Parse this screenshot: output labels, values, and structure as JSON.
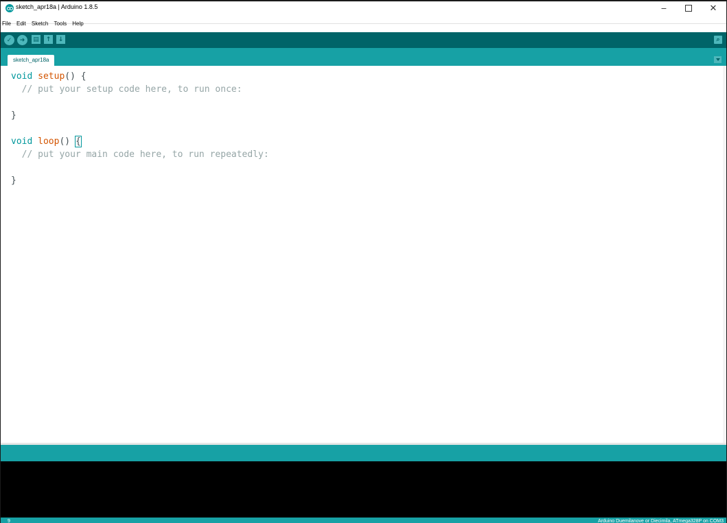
{
  "window": {
    "title": "sketch_apr18a | Arduino 1.8.5",
    "controls": {
      "minimize": "−",
      "close": "✕"
    }
  },
  "menu": [
    "File",
    "Edit",
    "Sketch",
    "Tools",
    "Help"
  ],
  "toolbar": {
    "verify_icon": "check-icon",
    "upload_icon": "arrow-right-icon",
    "new_icon": "new-file-icon",
    "open_icon": "open-arrow-up-icon",
    "save_icon": "save-arrow-down-icon",
    "serial_monitor_icon": "magnifier-icon"
  },
  "tabs": [
    {
      "label": "sketch_apr18a"
    }
  ],
  "editor": {
    "lines": [
      {
        "keyword": "void ",
        "func": "setup",
        "rest": "() {"
      },
      {
        "comment": "  // put your setup code here, to run once:"
      },
      {
        "plain": ""
      },
      {
        "plain": "}"
      },
      {
        "plain": ""
      },
      {
        "keyword": "void ",
        "func": "loop",
        "rest": "() ",
        "brace": "{"
      },
      {
        "comment": "  // put your main code here, to run repeatedly:"
      },
      {
        "plain": ""
      },
      {
        "plain": "}"
      }
    ]
  },
  "status": {
    "line_number": "9",
    "board": "Arduino Duemilanove or Diecimila, ATmega328P on COM3"
  },
  "colors": {
    "toolbar": "#006468",
    "tabbar": "#17a1a5",
    "keyword": "#00979c",
    "function": "#d35400",
    "comment": "#95a5a6"
  }
}
